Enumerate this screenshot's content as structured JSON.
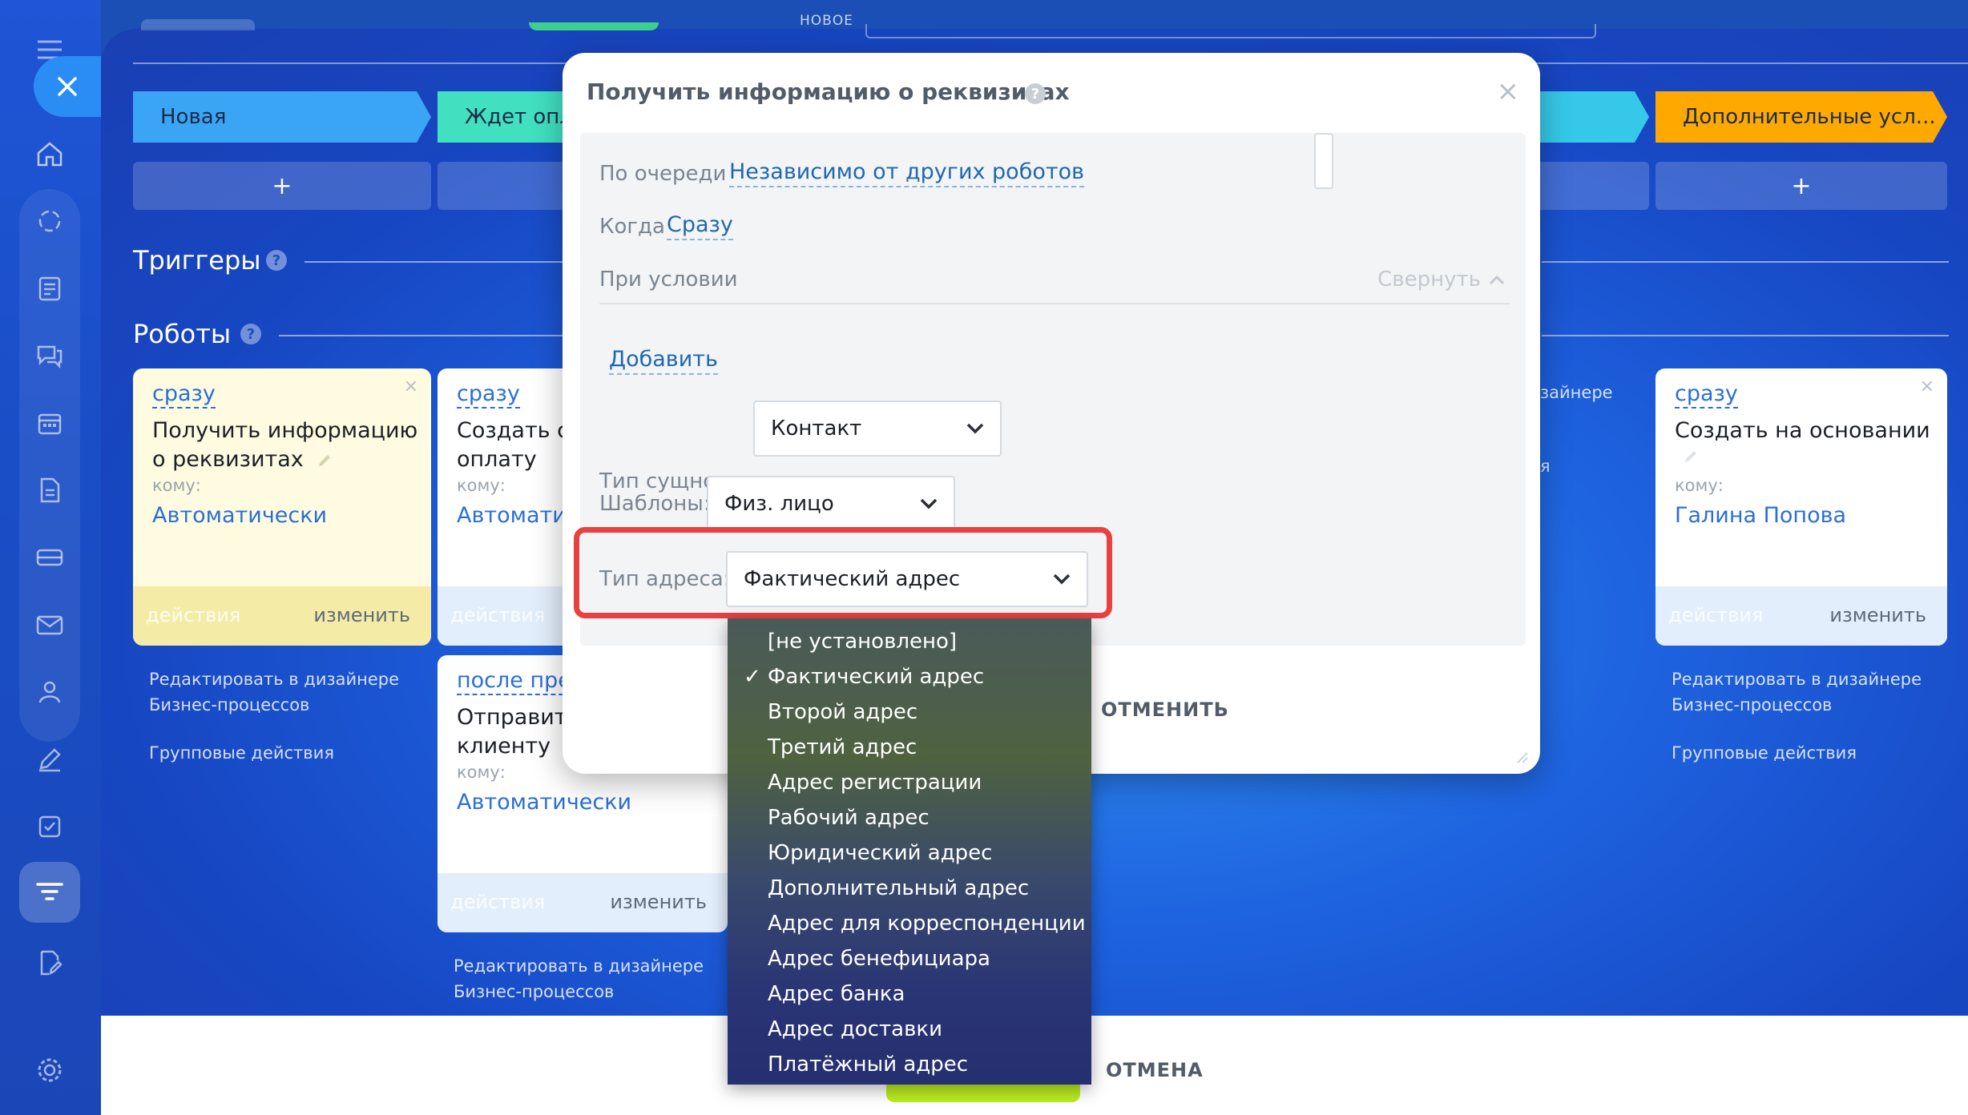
{
  "top_label": "НОВОЕ",
  "stages": [
    {
      "label": "Новая",
      "color": "#3aa5f5"
    },
    {
      "label": "Ждет опл",
      "color": "#40e0c0"
    },
    {
      "label": "Дополнительные усл...",
      "color": "#ffa900"
    }
  ],
  "plus": "+",
  "triggers": {
    "title": "Триггеры",
    "help": "?"
  },
  "robots": {
    "title": "Роботы",
    "help": "?"
  },
  "cards": {
    "c1": {
      "when": "сразу",
      "title_line1": "Получить информацию",
      "title_line2": "о реквизитах",
      "whom_label": "кому:",
      "whom": "Автоматически",
      "actions": "действия",
      "edit": "изменить",
      "close": "×"
    },
    "c2": {
      "when": "сразу",
      "title_line1": "Создать с",
      "title_line2": "оплату",
      "whom_label": "кому:",
      "whom": "Автомати",
      "actions": "действия"
    },
    "c3": {
      "when": "после пре",
      "title_line1": "Отправит",
      "title_line2": "клиенту",
      "whom_label": "кому:",
      "whom": "Автоматически",
      "actions": "действия",
      "edit": "изменить"
    },
    "c4": {
      "when": "сразу",
      "title_line1": "Создать на основании",
      "whom_label": "кому:",
      "whom": "Галина Попова",
      "actions": "действия",
      "edit": "изменить",
      "close": "×"
    }
  },
  "bp_links": {
    "line1": "Редактировать в дизайнере",
    "line2": "Бизнес-процессов",
    "group": "Групповые действия",
    "partial1": "зайнере",
    "partial2": "я"
  },
  "modal": {
    "title": "Получить информацию о реквизитах",
    "help": "?",
    "close": "×",
    "queue_label": "По очереди",
    "queue_value": "Независимо от других роботов",
    "when_label": "Когда",
    "when_value": "Сразу",
    "condition_label": "При условии",
    "collapse": "Свернуть",
    "add": "Добавить",
    "entity_label": "Тип сущности:",
    "entity_value": "Контакт",
    "templates_label": "Шаблоны:",
    "templates_value": "Физ. лицо",
    "address_label": "Тип адреса:",
    "address_value": "Фактический адрес",
    "cancel": "ОТМЕНИТЬ"
  },
  "dropdown": {
    "selected_index": 1,
    "check": "✓",
    "options": [
      "[не установлено]",
      "Фактический адрес",
      "Второй адрес",
      "Третий адрес",
      "Адрес регистрации",
      "Рабочий адрес",
      "Юридический адрес",
      "Дополнительный адрес",
      "Адрес для корреспонденции",
      "Адрес бенефициара",
      "Адрес банка",
      "Адрес доставки",
      "Платёжный адрес"
    ]
  },
  "bottom": {
    "cancel": "ОТМЕНА"
  },
  "colors": {
    "accent_red": "#e8413f",
    "link_blue": "#2067b0",
    "card_yellow": "#fffbe0"
  }
}
